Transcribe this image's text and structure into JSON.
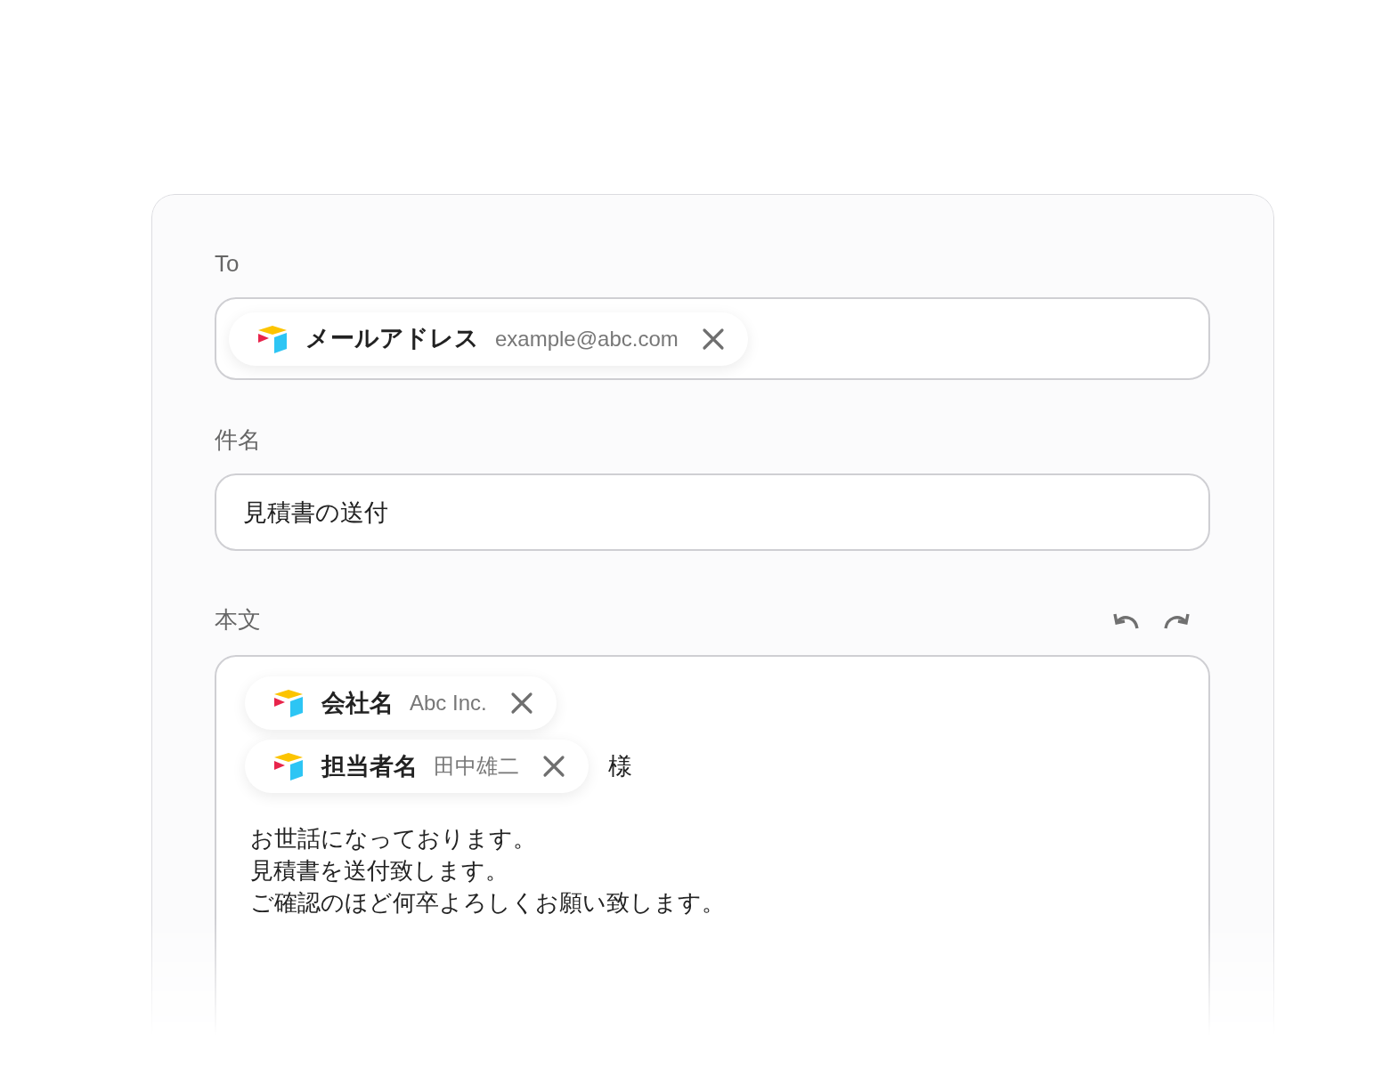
{
  "to": {
    "label": "To",
    "chips": [
      {
        "name": "メールアドレス",
        "value": "example@abc.com"
      }
    ]
  },
  "subject": {
    "label": "件名",
    "value": "見積書の送付"
  },
  "body": {
    "label": "本文",
    "rows": [
      {
        "chips": [
          {
            "name": "会社名",
            "value": "Abc Inc."
          }
        ]
      },
      {
        "chips": [
          {
            "name": "担当者名",
            "value": "田中雄二"
          }
        ],
        "suffix": "様"
      }
    ],
    "lines": [
      "お世話になっております。",
      "見積書を送付致します。",
      "ご確認のほど何卒よろしくお願い致します。"
    ]
  }
}
